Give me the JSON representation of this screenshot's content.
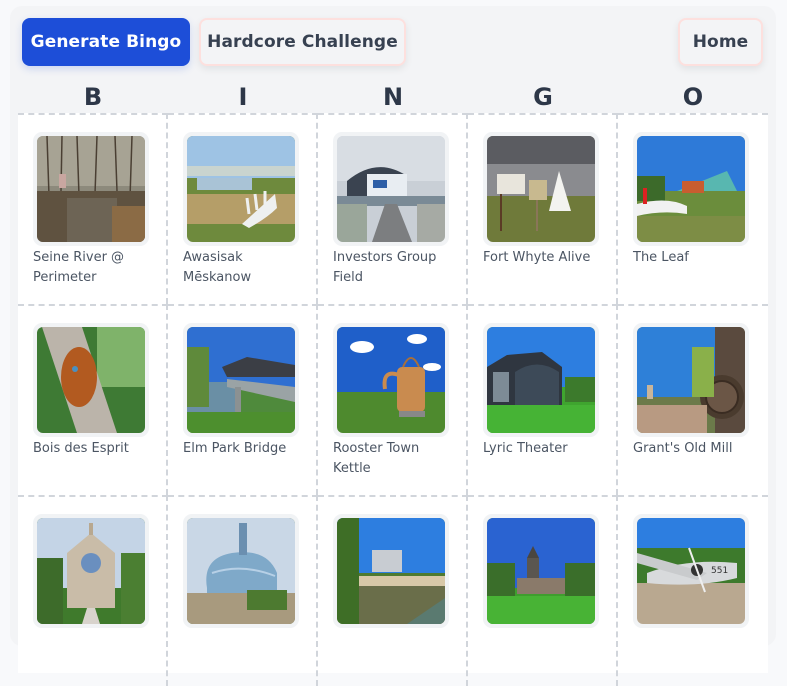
{
  "toolbar": {
    "generate_label": "Generate Bingo",
    "hardcore_label": "Hardcore Challenge",
    "home_label": "Home"
  },
  "colors": {
    "primary": "#1d4ed8",
    "outline_border": "#fde0de",
    "panel_bg": "#f3f4f6",
    "grid_line": "#d1d5db"
  },
  "letters": [
    "B",
    "I",
    "N",
    "G",
    "O"
  ],
  "cells": [
    {
      "label": "Seine River @ Perimeter",
      "scene": "river-autumn"
    },
    {
      "label": "Awasisak Mēskanow",
      "scene": "antler-sculpture"
    },
    {
      "label": "Investors Group Field",
      "scene": "stadium"
    },
    {
      "label": "Fort Whyte Alive",
      "scene": "tipi"
    },
    {
      "label": "The Leaf",
      "scene": "glass-canopy"
    },
    {
      "label": "Bois des Esprit",
      "scene": "tree-carving"
    },
    {
      "label": "Elm Park Bridge",
      "scene": "bridge"
    },
    {
      "label": "Rooster Town Kettle",
      "scene": "kettle"
    },
    {
      "label": "Lyric Theater",
      "scene": "theater"
    },
    {
      "label": "Grant's Old Mill",
      "scene": "mill"
    },
    {
      "label": "",
      "scene": "cathedral"
    },
    {
      "label": "",
      "scene": "museum"
    },
    {
      "label": "",
      "scene": "pond"
    },
    {
      "label": "",
      "scene": "pavilion"
    },
    {
      "label": "",
      "scene": "airplane"
    }
  ]
}
